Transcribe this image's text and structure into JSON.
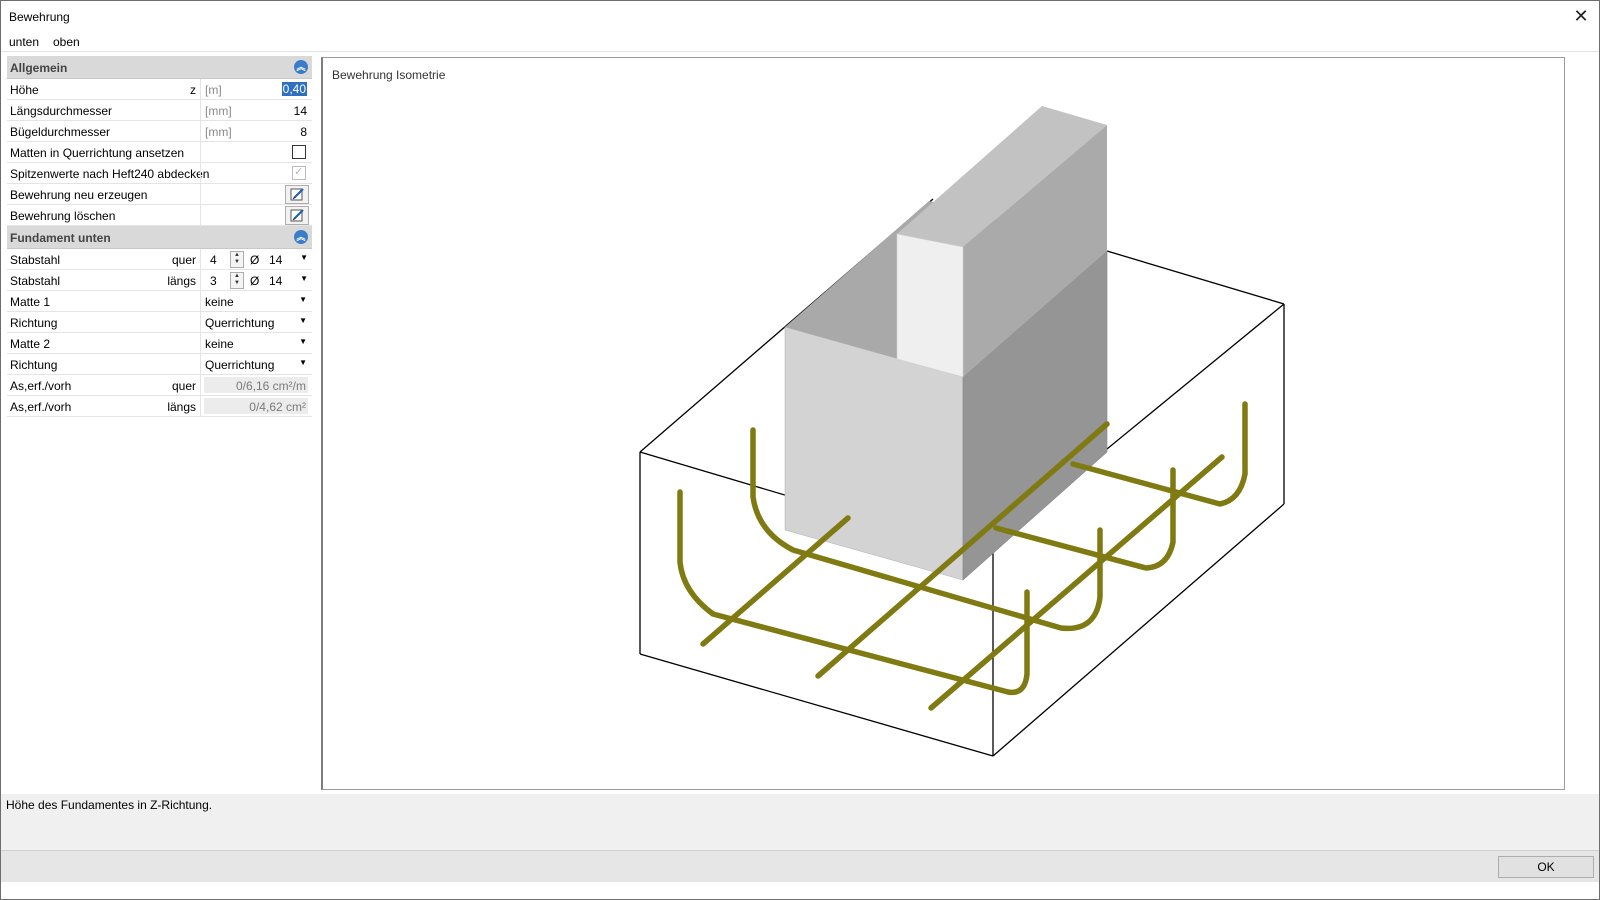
{
  "window": {
    "title": "Bewehrung"
  },
  "menu": {
    "tabs": [
      "unten",
      "oben"
    ]
  },
  "groups": {
    "general": {
      "title": "Allgemein"
    },
    "foundation": {
      "title": "Fundament unten"
    }
  },
  "general_rows": {
    "height": {
      "label": "Höhe",
      "axis": "z",
      "unit": "[m]",
      "value": "0,40"
    },
    "long_diameter": {
      "label": "Längsdurchmesser",
      "unit": "[mm]",
      "value": "14"
    },
    "stirrup_diameter": {
      "label": "Bügeldurchmesser",
      "unit": "[mm]",
      "value": "8"
    },
    "mats_transverse": {
      "label": "Matten in Querrichtung ansetzen",
      "checked": false
    },
    "peak_values": {
      "label": "Spitzenwerte nach Heft240 abdecken",
      "checked": true,
      "disabled": true
    },
    "regenerate": {
      "label": "Bewehrung neu erzeugen"
    },
    "delete": {
      "label": "Bewehrung löschen"
    }
  },
  "foundation_rows": {
    "bar_transverse": {
      "label": "Stabstahl",
      "dir": "quer",
      "count": "4",
      "phi": "Ø",
      "diameter": "14"
    },
    "bar_longitudinal": {
      "label": "Stabstahl",
      "dir": "längs",
      "count": "3",
      "phi": "Ø",
      "diameter": "14"
    },
    "mat1": {
      "label": "Matte 1",
      "value": "keine"
    },
    "dir1": {
      "label": "Richtung",
      "value": "Querrichtung"
    },
    "mat2": {
      "label": "Matte 2",
      "value": "keine"
    },
    "dir2": {
      "label": "Richtung",
      "value": "Querrichtung"
    },
    "as_quer": {
      "label": "As,erf./vorh",
      "dir": "quer",
      "value": "0/6,16 cm²/m"
    },
    "as_laengs": {
      "label": "As,erf./vorh",
      "dir": "längs",
      "value": "0/4,62 cm²"
    }
  },
  "viewport": {
    "title": "Bewehrung Isometrie"
  },
  "colors": {
    "rebar": "#7f7a12",
    "accent": "#3d7cc9"
  },
  "status": {
    "text": "Höhe des Fundamentes in Z-Richtung."
  },
  "buttons": {
    "ok": "OK"
  }
}
